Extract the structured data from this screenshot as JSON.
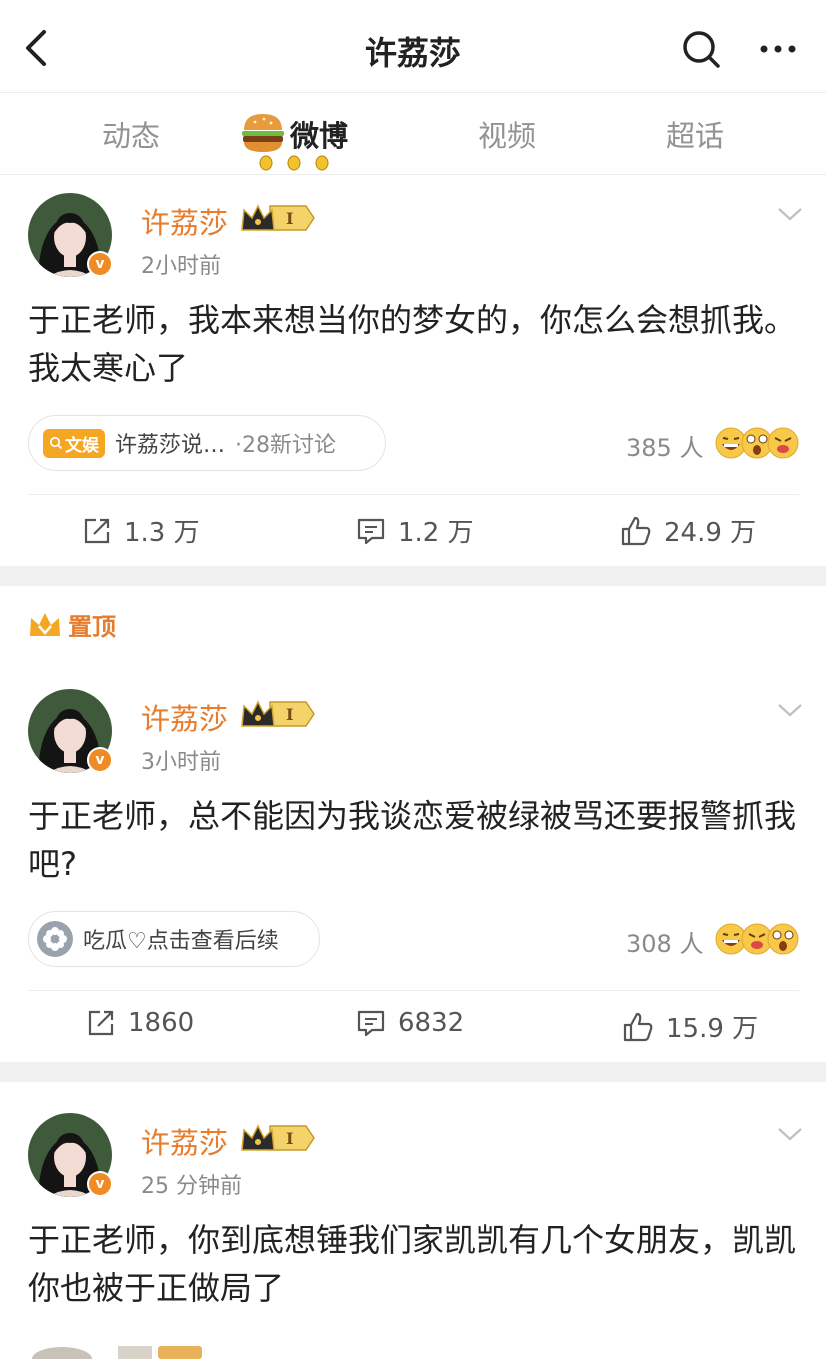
{
  "nav": {
    "title": "许荔莎"
  },
  "tabs": [
    {
      "label": "动态",
      "active": false
    },
    {
      "label": "微博",
      "active": true
    },
    {
      "label": "视频",
      "active": false
    },
    {
      "label": "超话",
      "active": false
    }
  ],
  "pinned_label": "置顶",
  "posts": [
    {
      "author": "许荔莎",
      "time": "2小时前",
      "text": "于正老师，我本来想当你的梦女的，你怎么会想抓我。我太寒心了",
      "chip": {
        "tag": "文娱",
        "text": "许荔莎说…",
        "sub": "·28新讨论"
      },
      "reactions": "385 人",
      "reposts": "1.3 万",
      "comments": "1.2 万",
      "likes": "24.9 万"
    },
    {
      "author": "许荔莎",
      "time": "3小时前",
      "text": "于正老师，总不能因为我谈恋爱被绿被骂还要报警抓我吧?",
      "chip": {
        "text": "吃瓜♡点击查看后续"
      },
      "reactions": "308 人",
      "reposts": "1860",
      "comments": "6832",
      "likes": "15.9 万"
    },
    {
      "author": "许荔莎",
      "time": "25 分钟前",
      "text": "于正老师，你到底想锤我们家凯凯有几个女朋友，凯凯你也被于正做局了"
    }
  ],
  "colors": {
    "accent_orange": "#e77c2c",
    "badge_orange": "#f08a24",
    "divider": "#f1f1f1",
    "muted": "#8a8a8a"
  },
  "icons": [
    "back-icon",
    "search-icon",
    "more-icon",
    "burger-icon",
    "crown-level-badge",
    "verified-icon",
    "chevron-down-icon",
    "repost-icon",
    "comment-icon",
    "like-icon",
    "pin-crown-icon",
    "emoji-reactions"
  ]
}
